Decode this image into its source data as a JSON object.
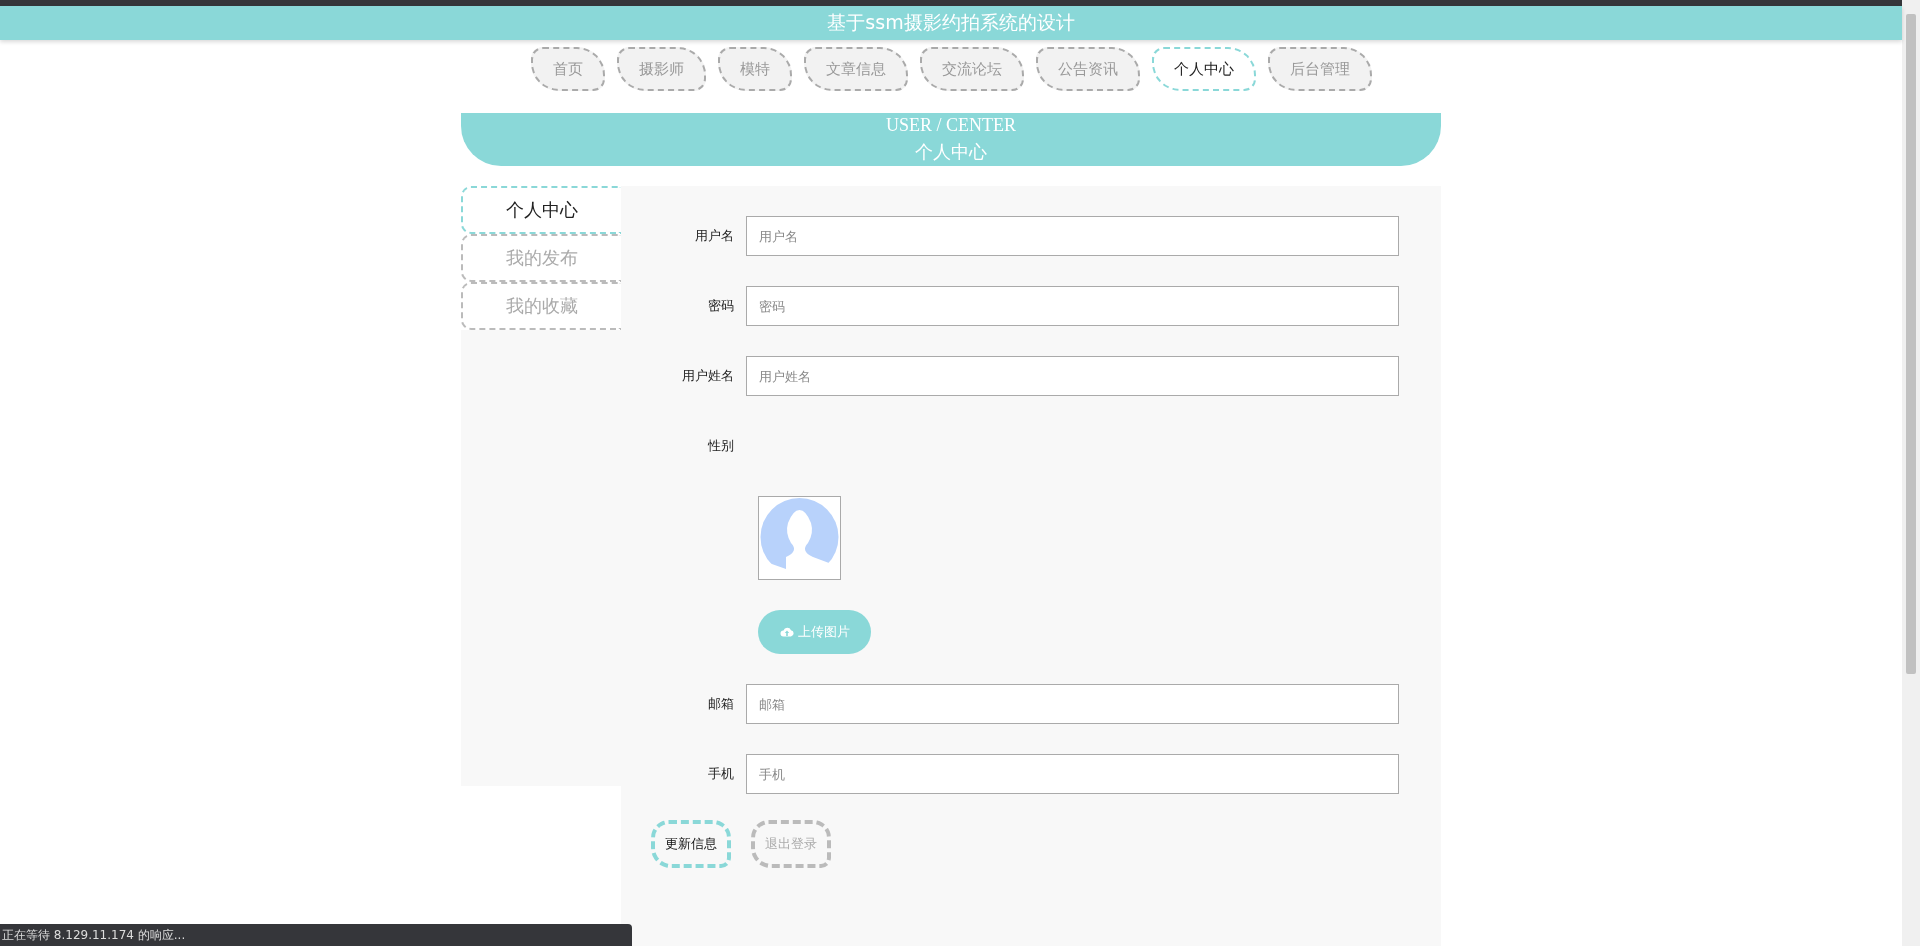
{
  "header": {
    "title": "基于ssm摄影约拍系统的设计"
  },
  "nav": [
    {
      "label": "首页",
      "selected": false
    },
    {
      "label": "摄影师",
      "selected": false
    },
    {
      "label": "模特",
      "selected": false
    },
    {
      "label": "文章信息",
      "selected": false
    },
    {
      "label": "交流论坛",
      "selected": false
    },
    {
      "label": "公告资讯",
      "selected": false
    },
    {
      "label": "个人中心",
      "selected": true
    },
    {
      "label": "后台管理",
      "selected": false
    }
  ],
  "banner": {
    "title_en": "USER / CENTER",
    "title": "个人中心"
  },
  "side_menu": [
    {
      "label": "个人中心",
      "selected": true
    },
    {
      "label": "我的发布",
      "selected": false
    },
    {
      "label": "我的收藏",
      "selected": false
    }
  ],
  "form": {
    "fields": [
      {
        "kind": "text",
        "label": "用户名",
        "placeholder": "用户名"
      },
      {
        "kind": "text",
        "label": "密码",
        "placeholder": "密码"
      },
      {
        "kind": "text",
        "label": "用户姓名",
        "placeholder": "用户姓名"
      },
      {
        "kind": "empty",
        "label": "性别"
      },
      {
        "kind": "avatar",
        "upload": "上传图片"
      },
      {
        "kind": "text",
        "label": "邮箱",
        "placeholder": "邮箱"
      },
      {
        "kind": "text",
        "label": "手机",
        "placeholder": "手机"
      }
    ],
    "buttons": [
      {
        "label": "更新信息",
        "kind": "primary"
      },
      {
        "label": "退出登录",
        "kind": "secondary"
      }
    ]
  },
  "status_bar": {
    "text": "正在等待 8.129.11.174 的响应..."
  }
}
